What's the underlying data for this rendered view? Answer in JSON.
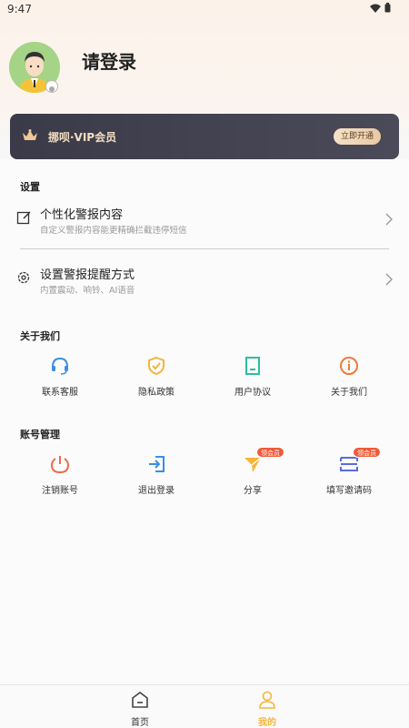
{
  "status_bar": {
    "time": "9:47"
  },
  "profile": {
    "login_text": "请登录"
  },
  "vip": {
    "label": "挪呗·VIP会员",
    "button": "立即开通"
  },
  "settings": {
    "section_title": "设置",
    "items": [
      {
        "title": "个性化警报内容",
        "subtitle": "自定义警报内容能更精确拦截违停短信"
      },
      {
        "title": "设置警报提醒方式",
        "subtitle": "内置震动、响铃、AI语音"
      }
    ]
  },
  "about": {
    "section_title": "关于我们",
    "items": [
      {
        "label": "联系客服",
        "icon": "headset-icon"
      },
      {
        "label": "隐私政策",
        "icon": "shield-icon"
      },
      {
        "label": "用户协议",
        "icon": "document-icon"
      },
      {
        "label": "关于我们",
        "icon": "info-icon"
      }
    ]
  },
  "account": {
    "section_title": "账号管理",
    "items": [
      {
        "label": "注销账号",
        "icon": "power-icon"
      },
      {
        "label": "退出登录",
        "icon": "logout-icon"
      },
      {
        "label": "分享",
        "icon": "send-icon",
        "badge": "领会员"
      },
      {
        "label": "填写邀请码",
        "icon": "ticket-icon",
        "badge": "领会员"
      }
    ]
  },
  "tab_bar": {
    "tabs": [
      {
        "label": "首页",
        "active": false
      },
      {
        "label": "我的",
        "active": true
      }
    ]
  },
  "colors": {
    "accent": "#f5b53a",
    "vip_bg": "#3d3d4b",
    "badge": "#f05a3a"
  }
}
